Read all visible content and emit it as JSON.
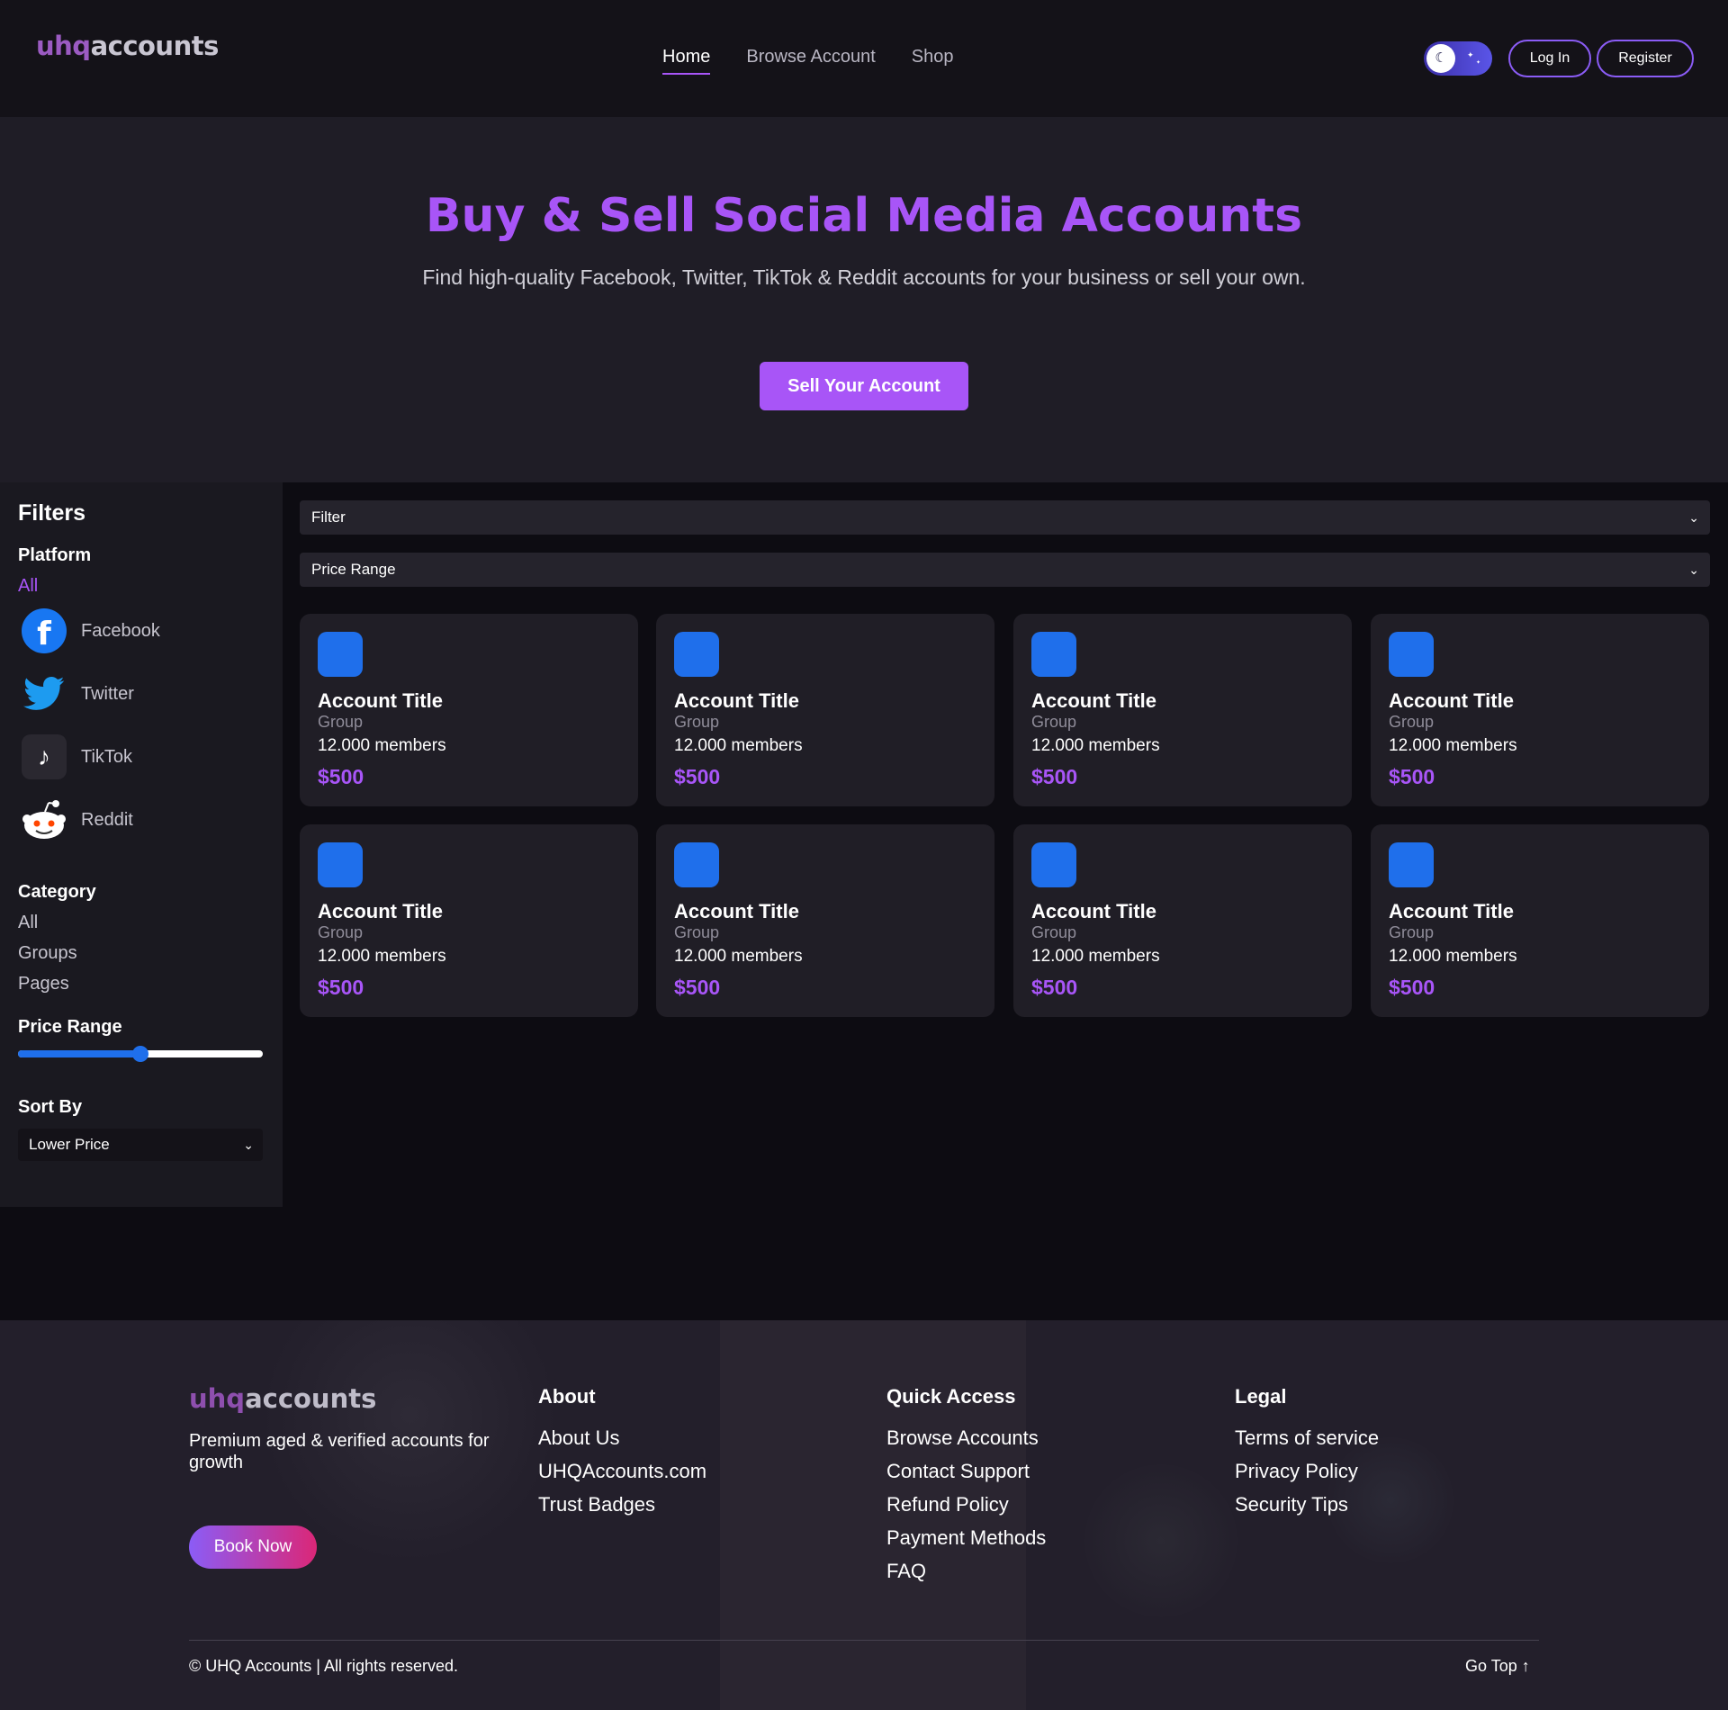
{
  "header": {
    "logo": {
      "part1": "uhq",
      "part2": "accounts"
    },
    "nav": [
      "Home",
      "Browse Account",
      "Shop"
    ],
    "login_label": "Log In",
    "register_label": "Register"
  },
  "hero": {
    "title": "Buy & Sell Social Media Accounts",
    "subtitle": "Find high-quality Facebook, Twitter, TikTok & Reddit accounts for your business or sell your own.",
    "cta_label": "Sell Your Account"
  },
  "sidebar": {
    "title": "Filters",
    "platform_heading": "Platform",
    "platform_all": "All",
    "platforms": [
      {
        "label": "Facebook",
        "icon": "facebook-icon"
      },
      {
        "label": "Twitter",
        "icon": "twitter-icon"
      },
      {
        "label": "TikTok",
        "icon": "tiktok-icon"
      },
      {
        "label": "Reddit",
        "icon": "reddit-icon"
      }
    ],
    "category_heading": "Category",
    "categories": [
      "All",
      "Groups",
      "Pages"
    ],
    "price_heading": "Price Range",
    "price_slider_fraction": 0.5,
    "sort_heading": "Sort By",
    "sort_value": "Lower Price"
  },
  "main": {
    "filter_placeholder": "Filter",
    "price_range_placeholder": "Price Range",
    "cards": [
      {
        "title": "Account Title",
        "type": "Group",
        "members": "12.000 members",
        "price": "$500"
      },
      {
        "title": "Account Title",
        "type": "Group",
        "members": "12.000 members",
        "price": "$500"
      },
      {
        "title": "Account Title",
        "type": "Group",
        "members": "12.000 members",
        "price": "$500"
      },
      {
        "title": "Account Title",
        "type": "Group",
        "members": "12.000 members",
        "price": "$500"
      },
      {
        "title": "Account Title",
        "type": "Group",
        "members": "12.000 members",
        "price": "$500"
      },
      {
        "title": "Account Title",
        "type": "Group",
        "members": "12.000 members",
        "price": "$500"
      },
      {
        "title": "Account Title",
        "type": "Group",
        "members": "12.000 members",
        "price": "$500"
      },
      {
        "title": "Account Title",
        "type": "Group",
        "members": "12.000 members",
        "price": "$500"
      }
    ]
  },
  "footer": {
    "logo": {
      "part1": "uhq",
      "part2": "accounts"
    },
    "tagline": "Premium aged & verified accounts for growth",
    "book_label": "Book Now",
    "about": {
      "heading": "About",
      "links": [
        "About Us",
        "UHQAccounts.com",
        "Trust Badges"
      ]
    },
    "quick": {
      "heading": "Quick Access",
      "links": [
        "Browse Accounts",
        "Contact Support",
        "Refund Policy",
        "Payment Methods",
        "FAQ"
      ]
    },
    "legal": {
      "heading": "Legal",
      "links": [
        "Terms of service",
        "Privacy Policy",
        "Security Tips"
      ]
    },
    "copyright": "© UHQ Accounts | All rights reserved.",
    "go_top": "Go Top ↑"
  },
  "colors": {
    "accent": "#a855f7",
    "blue": "#1f6feb",
    "background": "#0d0c12"
  }
}
